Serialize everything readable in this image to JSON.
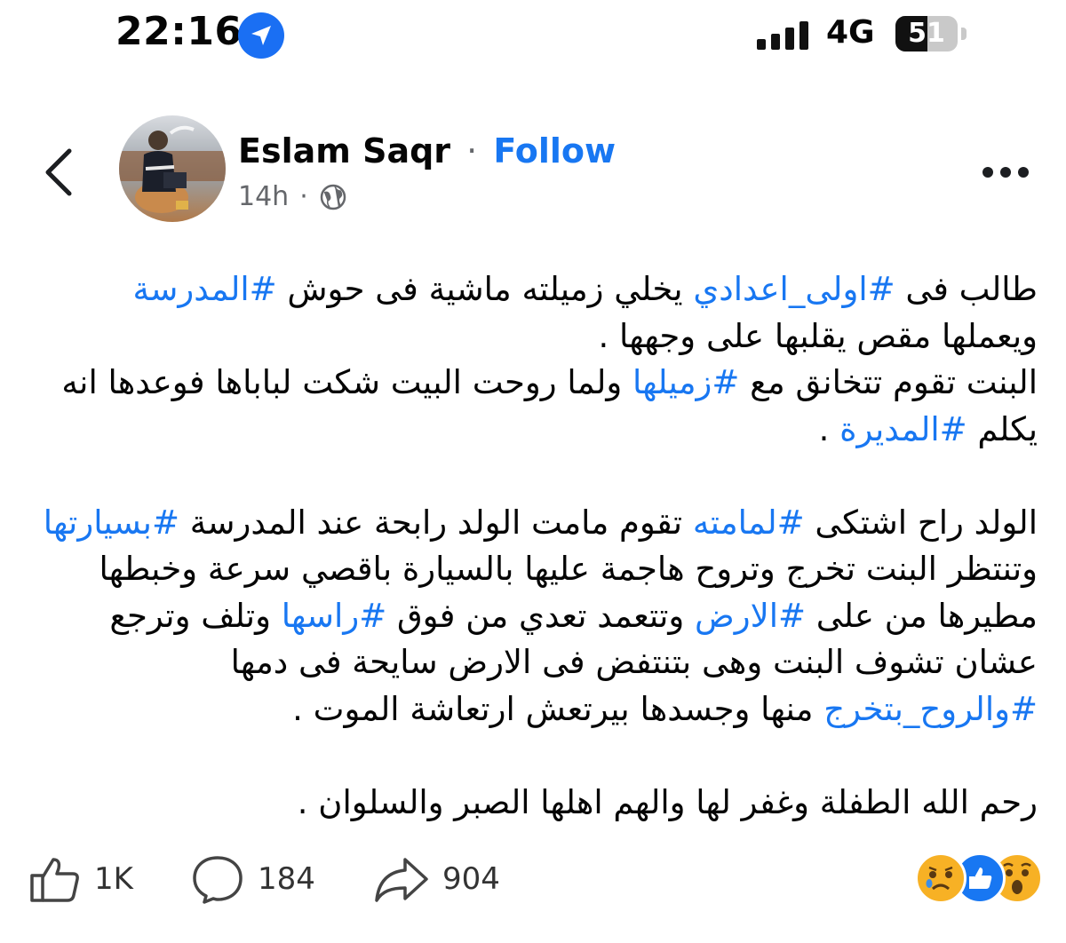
{
  "status_bar": {
    "time": "22:16",
    "network": "4G",
    "battery": "51",
    "battery_fraction": 0.51,
    "location_icon": "location-arrow-icon",
    "signal_icon": "signal-bars-icon"
  },
  "header": {
    "author_name": "Eslam Saqr",
    "separator": "·",
    "follow_label": "Follow",
    "timestamp": "14h",
    "meta_separator": "·",
    "audience_icon": "globe-icon",
    "back_icon": "chevron-left-icon",
    "more_icon": "more-horizontal-icon"
  },
  "post": {
    "p1": {
      "s1": "طالب فى ",
      "h1": "#اولى_اعدادي",
      "s2": " يخلي زميلته ماشية فى حوش ",
      "h2": "#المدرسة",
      "s3": " ويعملها مقص يقلبها على وجهها ."
    },
    "p2": {
      "s1": "البنت تقوم تتخانق مع ",
      "h1": "#زميلها",
      "s2": " ولما روحت البيت شكت لباباها فوعدها انه يكلم ",
      "h2": "#المديرة",
      "s3": " ."
    },
    "p3": {
      "s1": "الولد راح اشتكى ",
      "h1": "#لمامته",
      "s2": " تقوم مامت الولد رابحة عند المدرسة ",
      "h2": "#بسيارتها",
      "s3": " وتنتظر البنت تخرج وتروح هاجمة عليها بالسيارة باقصي سرعة وخبطها مطيرها من على ",
      "h3": "#الارض",
      "s4": " وتتعمد تعدي من فوق ",
      "h4": "#راسها",
      "s5": " وتلف وترجع عشان تشوف البنت وهى بتنتفض فى الارض سايحة فى دمها ",
      "h5": "#والروح_بتخرج",
      "s6": " منها وجسدها بيرتعش ارتعاشة الموت ."
    },
    "p4": "رحم الله الطفلة وغفر لها والهم اهلها الصبر والسلوان ."
  },
  "footer": {
    "like_count": "1K",
    "comment_count": "184",
    "share_count": "904",
    "like_icon": "thumbs-up-icon",
    "comment_icon": "comment-bubble-icon",
    "share_icon": "share-arrow-icon",
    "reactions": [
      "sad-face-icon",
      "like-reaction-icon",
      "wow-face-icon"
    ]
  },
  "colors": {
    "hashtag": "#1877f2",
    "follow": "#1877f2",
    "secondary_text": "#65676b",
    "primary_text": "#050505"
  }
}
